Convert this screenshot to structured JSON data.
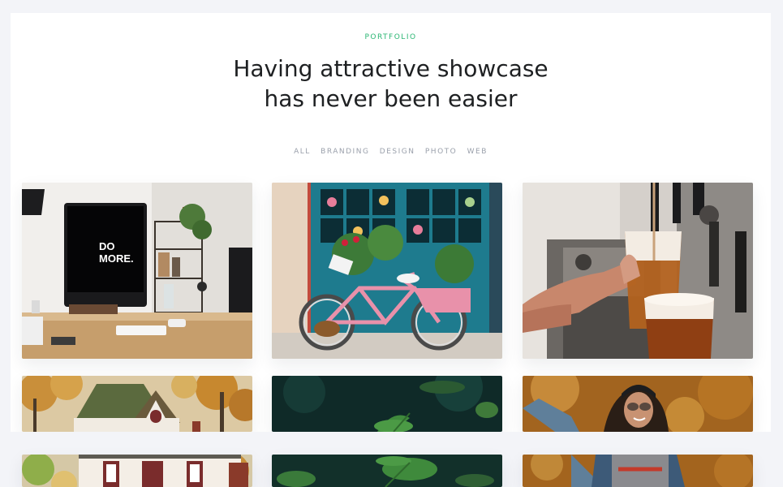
{
  "section": {
    "eyebrow": "PORTFOLIO",
    "title_line_1": "Having attractive showcase",
    "title_line_2": "has never been easier"
  },
  "filters": [
    "ALL",
    "BRANDING",
    "DESIGN",
    "PHOTO",
    "WEB"
  ],
  "tiles": [
    {
      "subject": "imac-desk-photo",
      "screen_text_1": "DO",
      "screen_text_2": "MORE."
    },
    {
      "subject": "pink-bicycle-photo"
    },
    {
      "subject": "beer-glasses-photo"
    },
    {
      "subject": "autumn-house-photo"
    },
    {
      "subject": "green-leaves-photo"
    },
    {
      "subject": "smiling-woman-photo"
    }
  ],
  "colors": {
    "accent": "#2bb673",
    "title": "#1e2022",
    "filter_text": "#9aa0ab",
    "page_bg": "#f3f4f8"
  }
}
